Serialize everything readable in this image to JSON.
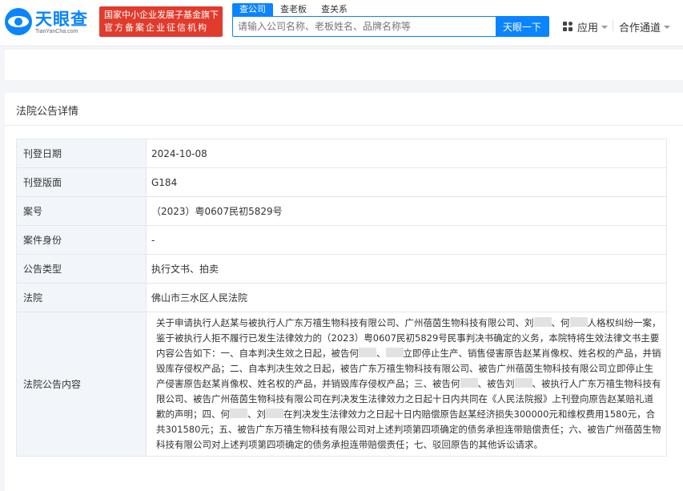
{
  "header": {
    "logo": {
      "name": "天眼查",
      "domain": "TianYanCha.com"
    },
    "badge": {
      "line1": "国家中小企业发展子基金旗下",
      "line2": "官方备案企业征信机构"
    },
    "search_tabs": [
      "查公司",
      "查老板",
      "查关系"
    ],
    "search": {
      "placeholder": "请输入公司名称、老板姓名、品牌名称等",
      "button": "天眼一下"
    },
    "nav": {
      "apps": "应用",
      "coop": "合作通道"
    }
  },
  "card": {
    "title": "法院公告详情"
  },
  "details": [
    {
      "label": "刊登日期",
      "value": "2024-10-08"
    },
    {
      "label": "刊登版面",
      "value": "G184"
    },
    {
      "label": "案号",
      "value": "（2023）粤0607民初5829号"
    },
    {
      "label": "案件身份",
      "value": "-"
    },
    {
      "label": "公告类型",
      "value": "执行文书、拍卖"
    },
    {
      "label": "法院",
      "value": "佛山市三水区人民法院"
    }
  ],
  "notice": {
    "label": "法院公告内容",
    "parts": [
      "关于申请执行人赵某与被执行人广东万禧生物科技有限公司、广州蓓茵生物科技有限公司、刘",
      "、何",
      "人格权纠纷一案，鉴于被执行人拒不履行已发生法律效力的（2023）粤0607民初5829号民事判决书确定的义务，本院特将生效法律文书主要内容公告如下：一、自本判决生效之日起，被告何",
      "、",
      "立即停止生产、销售侵害原告赵某肖像权、姓名权的产品，并销毁库存侵权产品；二、自本判决生效之日起，被告广东万禧生物科技有限公司、被告广州蓓茵生物科技有限公司立即停止生产侵害原告赵某肖像权、姓名权的产品，并销毁库存侵权产品；三、被告何",
      "、被告刘",
      "、被执行人广东万禧生物科技有限公司、被告广州蓓茵生物科技有限公司在判决发生法律效力之日起十日内共同在《人民法院报》上刊登向原告赵某赔礼道歉的声明；四、何",
      "、刘",
      "在判决发生法律效力之日起十日内赔偿原告赵某经济损失300000元和维权费用1580元，合共301580元；五、被告广东万禧生物科技有限公司对上述判项第四项确定的债务承担连带赔偿责任；六、被告广州蓓茵生物科技有限公司对上述判项第四项确定的债务承担连带赔偿责任；七、驳回原告的其他诉讼请求。"
    ]
  }
}
